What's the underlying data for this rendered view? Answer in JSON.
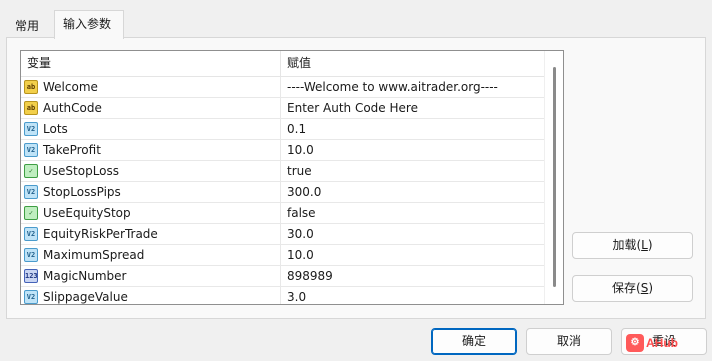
{
  "tabs": [
    {
      "label": "常用",
      "active": false
    },
    {
      "label": "输入参数",
      "active": true
    }
  ],
  "grid": {
    "columns": [
      "变量",
      "赋值"
    ],
    "rows": [
      {
        "type": "string",
        "icon": "ab",
        "name": "Welcome",
        "value": "----Welcome to www.aitrader.org----"
      },
      {
        "type": "string",
        "icon": "ab",
        "name": "AuthCode",
        "value": "Enter Auth Code Here"
      },
      {
        "type": "double",
        "icon": "V2",
        "name": "Lots",
        "value": "0.1"
      },
      {
        "type": "double",
        "icon": "V2",
        "name": "TakeProfit",
        "value": "10.0"
      },
      {
        "type": "bool",
        "icon": "✓",
        "name": "UseStopLoss",
        "value": "true"
      },
      {
        "type": "double",
        "icon": "V2",
        "name": "StopLossPips",
        "value": "300.0"
      },
      {
        "type": "bool",
        "icon": "✓",
        "name": "UseEquityStop",
        "value": "false"
      },
      {
        "type": "double",
        "icon": "V2",
        "name": "EquityRiskPerTrade",
        "value": "30.0"
      },
      {
        "type": "double",
        "icon": "V2",
        "name": "MaximumSpread",
        "value": "10.0"
      },
      {
        "type": "int",
        "icon": "123",
        "name": "MagicNumber",
        "value": "898989"
      },
      {
        "type": "double",
        "icon": "V2",
        "name": "SlippageValue",
        "value": "3.0"
      }
    ]
  },
  "side_buttons": {
    "load": {
      "label": "加载",
      "hotkey": "L"
    },
    "save": {
      "label": "保存",
      "hotkey": "S"
    }
  },
  "footer_buttons": {
    "ok": "确定",
    "cancel": "取消",
    "reset": "重设"
  },
  "watermark": "AHub",
  "colors": {
    "accent": "#0067c0",
    "background": "#f0f0f0",
    "panel": "#f9f9f9"
  }
}
